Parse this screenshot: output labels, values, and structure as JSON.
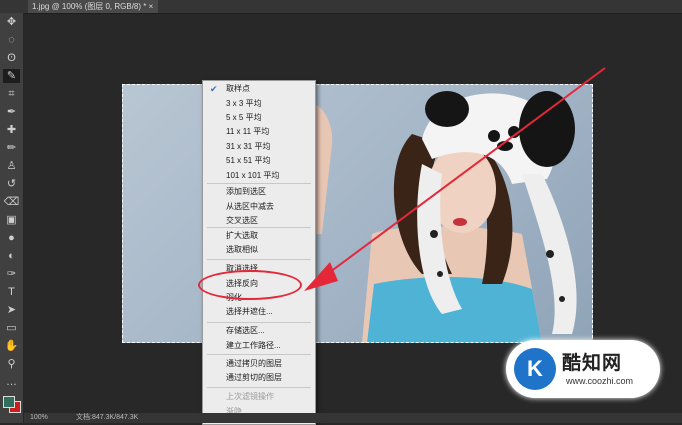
{
  "tab": {
    "title": "1.jpg @ 100% (图层 0, RGB/8) *",
    "close": "×"
  },
  "tools": [
    {
      "icon": "move-icon",
      "glyph": "✥"
    },
    {
      "icon": "marquee-icon",
      "glyph": "◌"
    },
    {
      "icon": "lasso-icon",
      "glyph": "ʘ"
    },
    {
      "icon": "magic-wand-icon",
      "glyph": "✎"
    },
    {
      "icon": "crop-icon",
      "glyph": "⌗"
    },
    {
      "icon": "eyedropper-icon",
      "glyph": "✒"
    },
    {
      "icon": "healing-brush-icon",
      "glyph": "✚"
    },
    {
      "icon": "brush-icon",
      "glyph": "✏"
    },
    {
      "icon": "clone-stamp-icon",
      "glyph": "♙"
    },
    {
      "icon": "history-brush-icon",
      "glyph": "↺"
    },
    {
      "icon": "eraser-icon",
      "glyph": "⌫"
    },
    {
      "icon": "gradient-icon",
      "glyph": "▣"
    },
    {
      "icon": "blur-icon",
      "glyph": "●"
    },
    {
      "icon": "dodge-icon",
      "glyph": "◐"
    },
    {
      "icon": "pen-icon",
      "glyph": "✑"
    },
    {
      "icon": "type-icon",
      "glyph": "T"
    },
    {
      "icon": "path-selection-icon",
      "glyph": "➤"
    },
    {
      "icon": "shape-icon",
      "glyph": "▭"
    },
    {
      "icon": "hand-icon",
      "glyph": "✋"
    },
    {
      "icon": "zoom-icon",
      "glyph": "⚲"
    },
    {
      "icon": "more-tools-icon",
      "glyph": "…"
    }
  ],
  "context_menu": {
    "items": [
      {
        "label": "取样点",
        "checked": true
      },
      {
        "label": "3 x 3 平均"
      },
      {
        "label": "5 x 5 平均"
      },
      {
        "label": "11 x 11 平均"
      },
      {
        "label": "31 x 31 平均"
      },
      {
        "label": "51 x 51 平均"
      },
      {
        "label": "101 x 101 平均"
      },
      {
        "label": "添加到选区"
      },
      {
        "label": "从选区中减去"
      },
      {
        "label": "交叉选区"
      },
      {
        "label": "扩大选取"
      },
      {
        "label": "选取相似"
      },
      {
        "label": "取消选择"
      },
      {
        "label": "选择反向"
      },
      {
        "label": "羽化..."
      },
      {
        "label": "选择并遮住..."
      },
      {
        "label": "存储选区..."
      },
      {
        "label": "建立工作路径..."
      },
      {
        "label": "通过拷贝的图层"
      },
      {
        "label": "通过剪切的图层"
      },
      {
        "label": "上次滤镜操作",
        "disabled": true
      },
      {
        "label": "渐隐...",
        "disabled": true
      }
    ]
  },
  "status": {
    "zoom": "100%",
    "doc": "文档:847.3K/847.3K"
  },
  "watermark": {
    "logo": "K",
    "name": "酷知网",
    "url": "www.coozhi.com"
  },
  "colors": {
    "annotation_red": "#e4283a",
    "selection_border": "#ffffff",
    "menu_bg": "#ececec"
  }
}
